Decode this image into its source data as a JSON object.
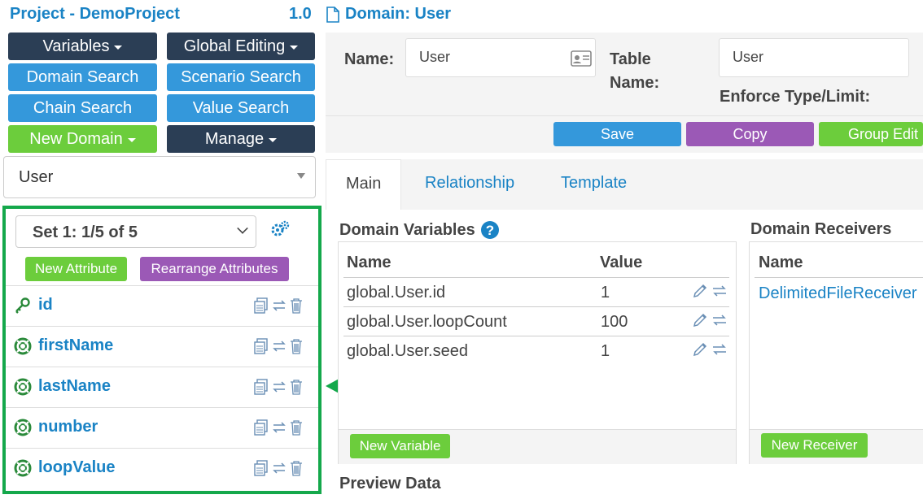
{
  "header": {
    "project_title": "Project - DemoProject",
    "version": "1.0",
    "domain_title": "Domain: User"
  },
  "left": {
    "buttons": {
      "variables": "Variables",
      "global_editing": "Global Editing",
      "domain_search": "Domain Search",
      "scenario_search": "Scenario Search",
      "chain_search": "Chain Search",
      "value_search": "Value Search",
      "new_domain": "New Domain",
      "manage": "Manage"
    },
    "domain_select": "User",
    "set_select": "Set 1: 1/5 of 5",
    "new_attribute": "New Attribute",
    "rearrange": "Rearrange Attributes",
    "attributes": [
      {
        "name": "id",
        "icon": "key-icon"
      },
      {
        "name": "firstName",
        "icon": "lifebuoy-icon"
      },
      {
        "name": "lastName",
        "icon": "lifebuoy-icon"
      },
      {
        "name": "number",
        "icon": "lifebuoy-icon"
      },
      {
        "name": "loopValue",
        "icon": "lifebuoy-icon"
      }
    ]
  },
  "form": {
    "name_label": "Name:",
    "name_value": "User",
    "table_name_label": "Table Name:",
    "table_name_value": "User",
    "enforce_label": "Enforce Type/Limit:"
  },
  "actions": {
    "save": "Save",
    "copy": "Copy",
    "group_edit": "Group Edit"
  },
  "tabs": [
    "Main",
    "Relationship",
    "Template"
  ],
  "domain_variables": {
    "title": "Domain Variables",
    "col_name": "Name",
    "col_value": "Value",
    "rows": [
      {
        "name": "global.User.id",
        "value": "1"
      },
      {
        "name": "global.User.loopCount",
        "value": "100"
      },
      {
        "name": "global.User.seed",
        "value": "1"
      }
    ],
    "new_button": "New Variable"
  },
  "domain_receivers": {
    "title": "Domain Receivers",
    "col_name": "Name",
    "rows": [
      "DelimitedFileReceiver"
    ],
    "new_button": "New Receiver"
  },
  "preview_title": "Preview Data",
  "colors": {
    "accent": "#1a83c5",
    "highlight_border": "#14a84b",
    "arrow": "#14a84b",
    "dark_button": "#2b3e55",
    "blue_button": "#3498db",
    "green_button": "#6ccd3c",
    "purple_button": "#9b59b6"
  }
}
